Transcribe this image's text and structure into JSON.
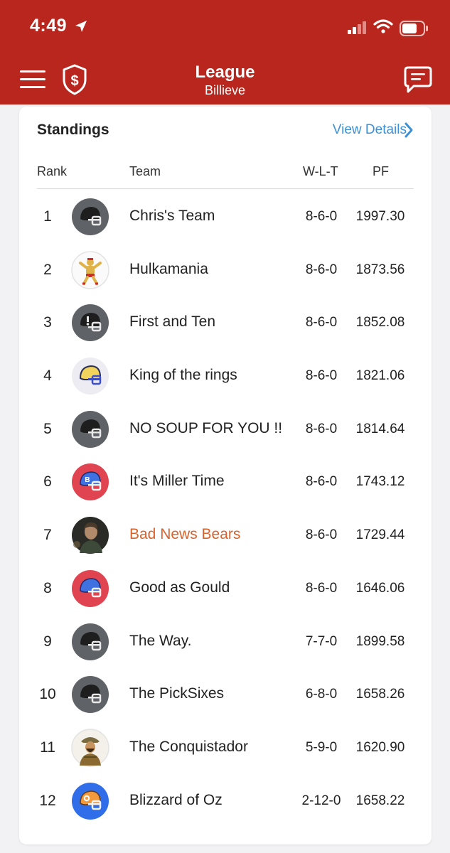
{
  "status_bar": {
    "time": "4:49"
  },
  "header": {
    "title": "League",
    "subtitle": "Billieve"
  },
  "card": {
    "title": "Standings",
    "view_details": "View Details"
  },
  "columns": {
    "rank": "Rank",
    "team": "Team",
    "wlt": "W-L-T",
    "pf": "PF"
  },
  "colors": {
    "header_bg": "#b8261d",
    "link": "#3d8fd6",
    "highlight_team": "#d9622b"
  },
  "standings": [
    {
      "rank": "1",
      "team": "Chris's Team",
      "wlt": "8-6-0",
      "pf": "1997.30",
      "avatar": "helmet-gray-icon"
    },
    {
      "rank": "2",
      "team": "Hulkamania",
      "wlt": "8-6-0",
      "pf": "1873.56",
      "avatar": "wrestler-photo"
    },
    {
      "rank": "3",
      "team": "First and Ten",
      "wlt": "8-6-0",
      "pf": "1852.08",
      "avatar": "helmet-gray-icon"
    },
    {
      "rank": "4",
      "team": "King of the rings",
      "wlt": "8-6-0",
      "pf": "1821.06",
      "avatar": "helmet-yellow-icon"
    },
    {
      "rank": "5",
      "team": "NO SOUP FOR YOU !!",
      "wlt": "8-6-0",
      "pf": "1814.64",
      "avatar": "helmet-gray-icon"
    },
    {
      "rank": "6",
      "team": "It's Miller Time",
      "wlt": "8-6-0",
      "pf": "1743.12",
      "avatar": "helmet-red-blue-icon"
    },
    {
      "rank": "7",
      "team": "Bad News Bears",
      "wlt": "8-6-0",
      "pf": "1729.44",
      "avatar": "team-photo",
      "highlight": true
    },
    {
      "rank": "8",
      "team": "Good as Gould",
      "wlt": "8-6-0",
      "pf": "1646.06",
      "avatar": "helmet-red-blue-icon"
    },
    {
      "rank": "9",
      "team": "The Way.",
      "wlt": "7-7-0",
      "pf": "1899.58",
      "avatar": "helmet-gray-icon"
    },
    {
      "rank": "10",
      "team": "The PickSixes",
      "wlt": "6-8-0",
      "pf": "1658.26",
      "avatar": "helmet-gray-icon"
    },
    {
      "rank": "11",
      "team": "The Conquistador",
      "wlt": "5-9-0",
      "pf": "1620.90",
      "avatar": "conquistador-photo"
    },
    {
      "rank": "12",
      "team": "Blizzard of Oz",
      "wlt": "2-12-0",
      "pf": "1658.22",
      "avatar": "helmet-blue-orange-icon"
    }
  ]
}
